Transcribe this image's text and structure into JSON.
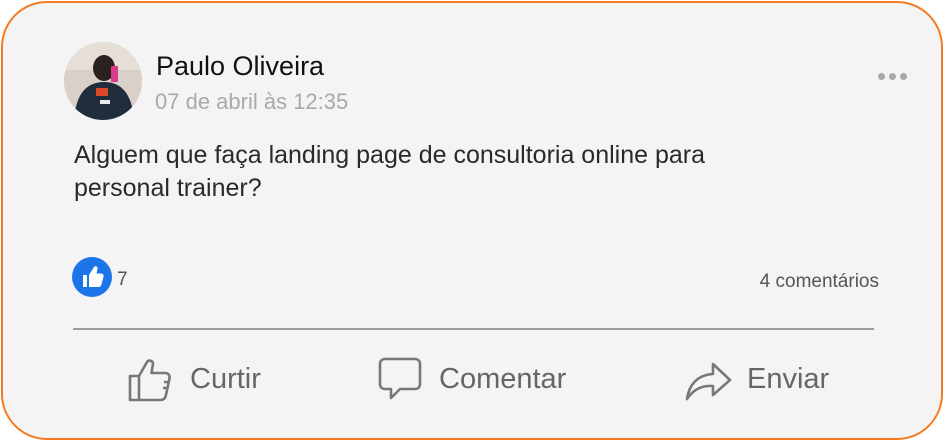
{
  "post": {
    "author": "Paulo Oliveira",
    "timestamp": "07 de abril às 12:35",
    "text": "Alguem que faça landing page de consultoria online para personal trainer?",
    "likes": "7",
    "comments": "4 comentários"
  },
  "actions": {
    "like_label": "Curtir",
    "comment_label": "Comentar",
    "share_label": "Enviar"
  },
  "colors": {
    "border": "#f47a1f",
    "card_background": "#f4f4f4",
    "reaction_blue": "#1b74e8"
  },
  "icons": {
    "more": "more-horizontal-icon",
    "reaction": "like-reaction-icon",
    "like": "thumbs-up-icon",
    "comment": "speech-bubble-icon",
    "share": "share-arrow-icon"
  }
}
